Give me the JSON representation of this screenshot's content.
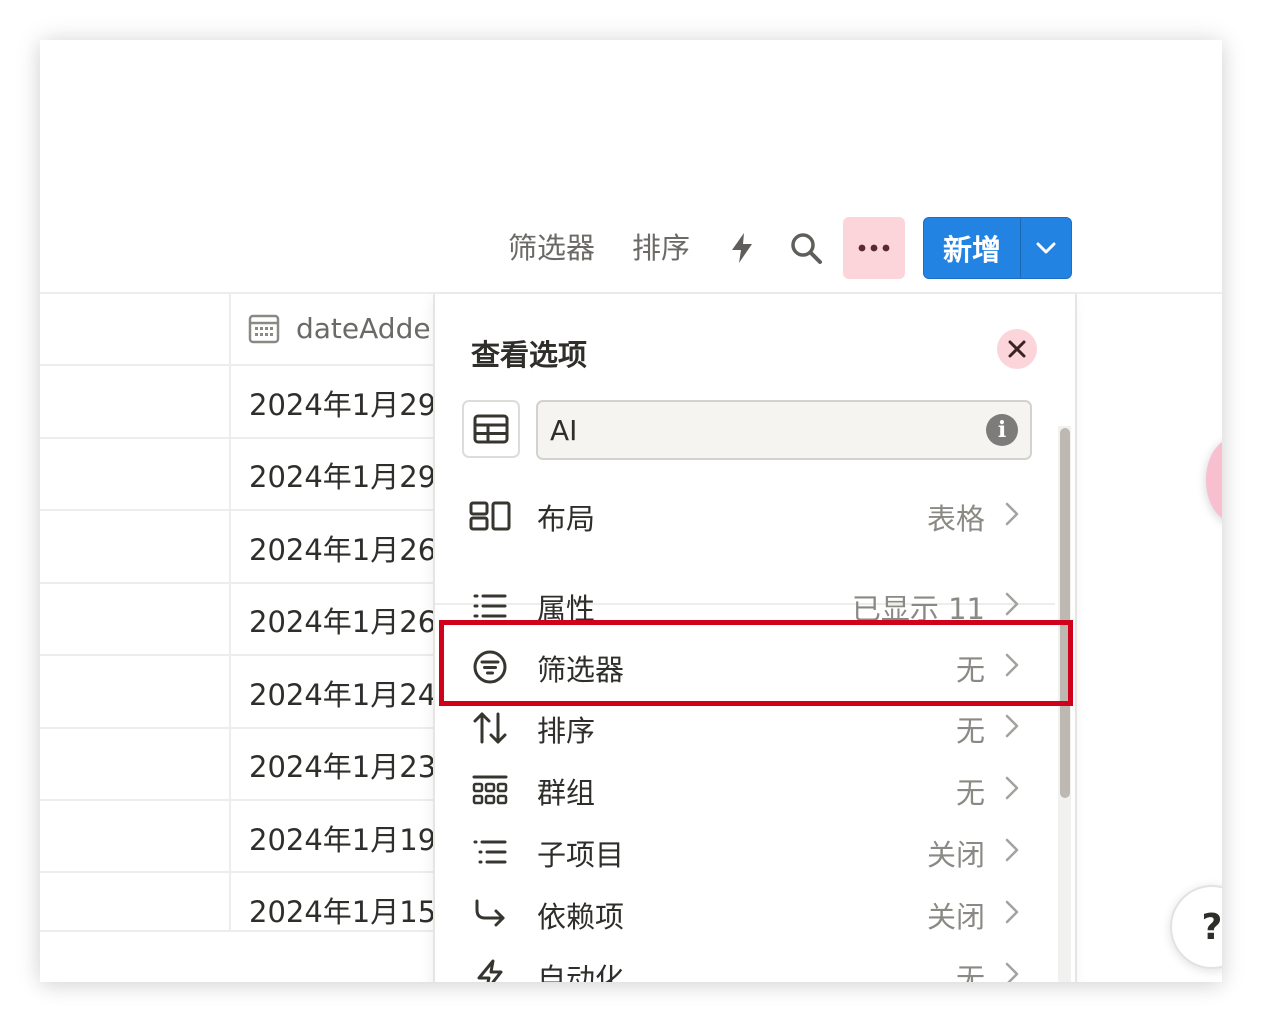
{
  "toolbar": {
    "filter_label": "筛选器",
    "sort_label": "排序",
    "new_label": "新增",
    "icons": [
      "lightning-icon",
      "search-icon",
      "more-icon",
      "chevron-down-icon"
    ]
  },
  "table": {
    "column_header": "dateAdde",
    "column_icon": "calendar-icon",
    "cells": [
      "2024年1月29",
      "2024年1月29",
      "2024年1月26",
      "2024年1月26",
      "2024年1月24",
      "2024年1月23",
      "2024年1月19",
      "2024年1月15"
    ]
  },
  "view_options": {
    "title": "查看选项",
    "view_name_value": "AI",
    "items": [
      {
        "label": "布局",
        "value": "表格",
        "icon": "layout-icon"
      },
      {
        "label": "属性",
        "value": "已显示 11",
        "icon": "properties-icon"
      },
      {
        "label": "筛选器",
        "value": "无",
        "icon": "filter-icon"
      },
      {
        "label": "排序",
        "value": "无",
        "icon": "sort-icon"
      },
      {
        "label": "群组",
        "value": "无",
        "icon": "group-icon"
      },
      {
        "label": "子项目",
        "value": "关闭",
        "icon": "sub-items-icon"
      },
      {
        "label": "依赖项",
        "value": "关闭",
        "icon": "dependencies-icon"
      },
      {
        "label": "自动化",
        "value": "无",
        "icon": "automation-icon"
      }
    ]
  },
  "help_label": "?",
  "colors": {
    "accent_blue": "#2383e2",
    "more_button_bg": "#fbd5d9",
    "highlight_red": "#d0021b"
  }
}
